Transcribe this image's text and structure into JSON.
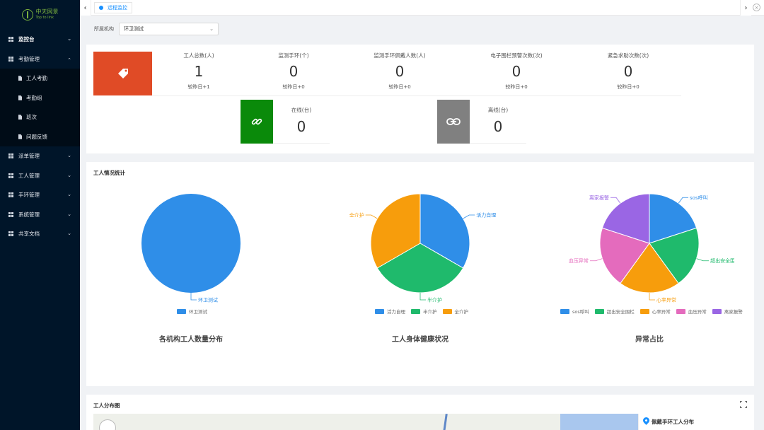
{
  "logo": {
    "name_cn": "中天网景",
    "name_en": "Top to link"
  },
  "sidebar": {
    "items": [
      {
        "label": "监控台",
        "active": true,
        "expanded": false
      },
      {
        "label": "考勤管理",
        "active": false,
        "expanded": true,
        "children": [
          "工人考勤",
          "考勤组",
          "班次",
          "问题反馈"
        ]
      },
      {
        "label": "派单管理"
      },
      {
        "label": "工人管理"
      },
      {
        "label": "手环管理"
      },
      {
        "label": "系统管理"
      },
      {
        "label": "共享文档"
      }
    ]
  },
  "tabs": {
    "active_label": "远程监控"
  },
  "filter": {
    "label": "所属机构",
    "value": "环卫测试"
  },
  "stats": [
    {
      "label": "工人总数(人)",
      "value": "1",
      "sub": "较昨日+1"
    },
    {
      "label": "监测手环(个)",
      "value": "0",
      "sub": "较昨日+0"
    },
    {
      "label": "监测手环佩戴人数(人)",
      "value": "0",
      "sub": "较昨日+0"
    },
    {
      "label": "电子围栏预警次数(次)",
      "value": "0",
      "sub": "较昨日+0"
    },
    {
      "label": "紧急求助次数(次)",
      "value": "0",
      "sub": "较昨日+0"
    }
  ],
  "devices": {
    "online": {
      "label": "在线(台)",
      "value": "0"
    },
    "offline": {
      "label": "离线(台)",
      "value": "0"
    }
  },
  "colors": {
    "orange": "#e04b26",
    "green": "#0a8a0a",
    "gray": "#808080",
    "blue": "#2f8ee8",
    "pie_green": "#1fba6c",
    "pie_orange": "#f79d0c",
    "pie_pink": "#e46bbd",
    "pie_purple": "#9a66e4"
  },
  "charts": {
    "section_title": "工人情况统计",
    "chart_data": [
      {
        "type": "pie",
        "title": "各机构工人数量分布",
        "slices": [
          {
            "name": "环卫测试",
            "value": 1,
            "color": "#2f8ee8"
          }
        ],
        "legend": [
          "环卫测试"
        ]
      },
      {
        "type": "pie",
        "title": "工人身体健康状况",
        "slices": [
          {
            "name": "活力自理",
            "value": 1,
            "color": "#2f8ee8"
          },
          {
            "name": "半介护",
            "value": 1,
            "color": "#1fba6c"
          },
          {
            "name": "全介护",
            "value": 1,
            "color": "#f79d0c"
          }
        ],
        "legend": [
          "活力自理",
          "半介护",
          "全介护"
        ]
      },
      {
        "type": "pie",
        "title": "异常占比",
        "slices": [
          {
            "name": "sos呼叫",
            "value": 1,
            "color": "#2f8ee8"
          },
          {
            "name": "超出安全围栏",
            "value": 1,
            "color": "#1fba6c"
          },
          {
            "name": "心率异常",
            "value": 1,
            "color": "#f79d0c"
          },
          {
            "name": "血压异常",
            "value": 1,
            "color": "#e46bbd"
          },
          {
            "name": "离家报警",
            "value": 1,
            "color": "#9a66e4"
          }
        ],
        "legend": [
          "sos呼叫",
          "超出安全围栏",
          "心率异常",
          "血压异常",
          "离家报警"
        ]
      }
    ]
  },
  "map": {
    "section_title": "工人分布图",
    "panel_title": "佩戴手环工人分布"
  }
}
